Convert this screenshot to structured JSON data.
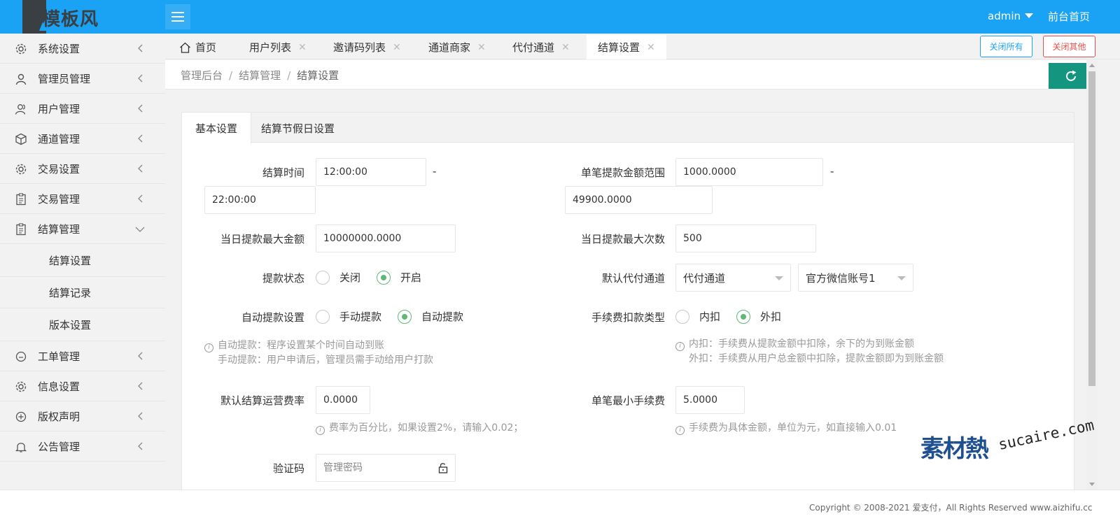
{
  "header": {
    "logo_text": "模板风",
    "user": "admin",
    "home_link": "前台首页"
  },
  "sidebar": {
    "items": [
      {
        "label": "系统设置",
        "icon": "gear-icon"
      },
      {
        "label": "管理员管理",
        "icon": "user-icon"
      },
      {
        "label": "用户管理",
        "icon": "users-icon"
      },
      {
        "label": "通道管理",
        "icon": "cube-icon"
      },
      {
        "label": "交易设置",
        "icon": "gear-icon"
      },
      {
        "label": "交易管理",
        "icon": "clipboard-icon"
      },
      {
        "label": "结算管理",
        "icon": "clipboard-icon",
        "expanded": true
      }
    ],
    "sub_items": [
      "结算设置",
      "结算记录",
      "版本设置"
    ],
    "items_after": [
      {
        "label": "工单管理",
        "icon": "circle-dots-icon"
      },
      {
        "label": "信息设置",
        "icon": "gear-icon"
      },
      {
        "label": "版权声明",
        "icon": "plus-circle-icon"
      },
      {
        "label": "公告管理",
        "icon": "bell-icon"
      }
    ]
  },
  "tabs": {
    "items": [
      {
        "label": "首页",
        "closable": false
      },
      {
        "label": "用户列表",
        "closable": true
      },
      {
        "label": "邀请码列表",
        "closable": true
      },
      {
        "label": "通道商家",
        "closable": true
      },
      {
        "label": "代付通道",
        "closable": true
      },
      {
        "label": "结算设置",
        "closable": true,
        "active": true
      }
    ],
    "close_all": "关闭所有",
    "close_other": "关闭其他"
  },
  "breadcrumb": {
    "items": [
      "管理后台",
      "结算管理",
      "结算设置"
    ]
  },
  "card": {
    "tabs": [
      "基本设置",
      "结算节假日设置"
    ]
  },
  "form": {
    "settle_time": {
      "label": "结算时间",
      "start": "12:00:00",
      "end": "22:00:00",
      "dash": "-"
    },
    "withdraw_range": {
      "label": "单笔提款金额范围",
      "min": "1000.0000",
      "max": "49900.0000",
      "dash": "-"
    },
    "daily_max_amount": {
      "label": "当日提款最大金额",
      "value": "10000000.0000"
    },
    "daily_max_count": {
      "label": "当日提款最大次数",
      "value": "500"
    },
    "withdraw_status": {
      "label": "提款状态",
      "options": [
        "关闭",
        "开启"
      ],
      "selected": "开启"
    },
    "default_channel": {
      "label": "默认代付通道",
      "channel": "代付通道",
      "account": "官方微信账号1"
    },
    "auto_withdraw": {
      "label": "自动提款设置",
      "options": [
        "手动提款",
        "自动提款"
      ],
      "selected": "自动提款",
      "tip1": "自动提款：程序设置某个时间自动到账",
      "tip2": "手动提款：用户申请后，管理员需手动给用户打款"
    },
    "fee_type": {
      "label": "手续费扣款类型",
      "options": [
        "内扣",
        "外扣"
      ],
      "selected": "外扣",
      "tip1": "内扣：手续费从提款金额中扣除，余下的为到账金额",
      "tip2": "外扣：手续费从用户总金额中扣除，提款金额即为到账金额"
    },
    "default_rate": {
      "label": "默认结算运营费率",
      "value": "0.0000",
      "tip": "费率为百分比，如果设置2%，请输入0.02；"
    },
    "min_fee": {
      "label": "单笔最小手续费",
      "value": "5.0000",
      "tip": "手续费为具体金额，单位为元，如直接输入0.01"
    },
    "captcha": {
      "label": "验证码",
      "placeholder": "管理密码"
    }
  },
  "footer": {
    "copyright": "Copyright © 2008-2021 爱支付，All Rights Reserved www.aizhifu.cc"
  },
  "watermark": {
    "cn": "素材熱",
    "en": "sucaire.com"
  },
  "colors": {
    "header": "#1aa3f5",
    "accent_green": "#5fb878",
    "refresh": "#13957f"
  }
}
